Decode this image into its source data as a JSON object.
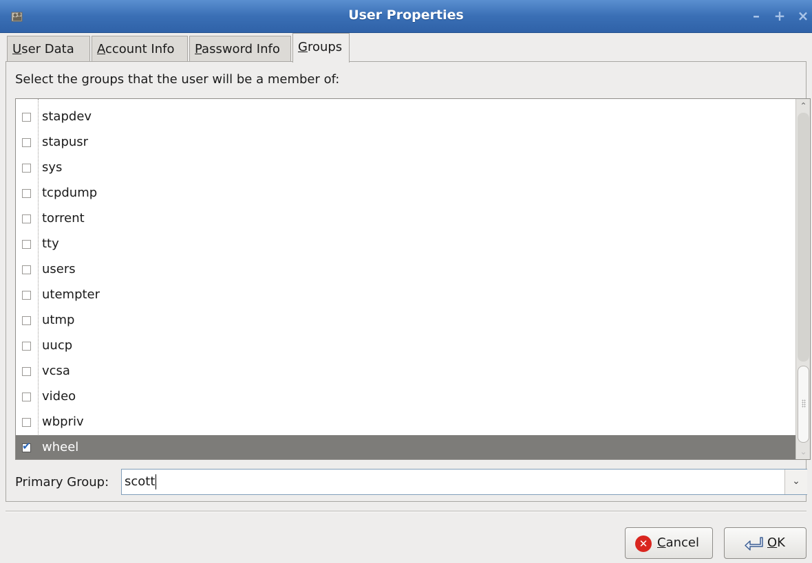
{
  "window": {
    "title": "User Properties",
    "controls": {
      "minimize": "–",
      "maximize": "+",
      "close": "×"
    }
  },
  "tabs": [
    {
      "label": "User Data",
      "mnemonic": "U",
      "rest": "ser Data",
      "active": false
    },
    {
      "label": "Account Info",
      "mnemonic": "A",
      "rest": "ccount Info",
      "active": false
    },
    {
      "label": "Password Info",
      "mnemonic": "P",
      "rest": "assword Info",
      "active": false
    },
    {
      "label": "Groups",
      "mnemonic": "G",
      "rest": "roups",
      "active": true
    }
  ],
  "groups_tab": {
    "prompt": "Select the groups that the user will be a member of:",
    "groups": [
      {
        "name": "stapdev",
        "checked": false
      },
      {
        "name": "stapusr",
        "checked": false
      },
      {
        "name": "sys",
        "checked": false
      },
      {
        "name": "tcpdump",
        "checked": false
      },
      {
        "name": "torrent",
        "checked": false
      },
      {
        "name": "tty",
        "checked": false
      },
      {
        "name": "users",
        "checked": false
      },
      {
        "name": "utempter",
        "checked": false
      },
      {
        "name": "utmp",
        "checked": false
      },
      {
        "name": "uucp",
        "checked": false
      },
      {
        "name": "vcsa",
        "checked": false
      },
      {
        "name": "video",
        "checked": false
      },
      {
        "name": "wbpriv",
        "checked": false
      },
      {
        "name": "wheel",
        "checked": true,
        "selected": true
      }
    ],
    "primary_group_label": "Primary Group:",
    "primary_group_value": "scott"
  },
  "buttons": {
    "cancel": {
      "mnemonic": "C",
      "rest": "ancel"
    },
    "ok": {
      "mnemonic": "O",
      "rest": "K"
    }
  },
  "colors": {
    "titlebar": "#3a6fb5",
    "selected_row": "#7d7c79",
    "cancel_icon": "#d9261f"
  }
}
